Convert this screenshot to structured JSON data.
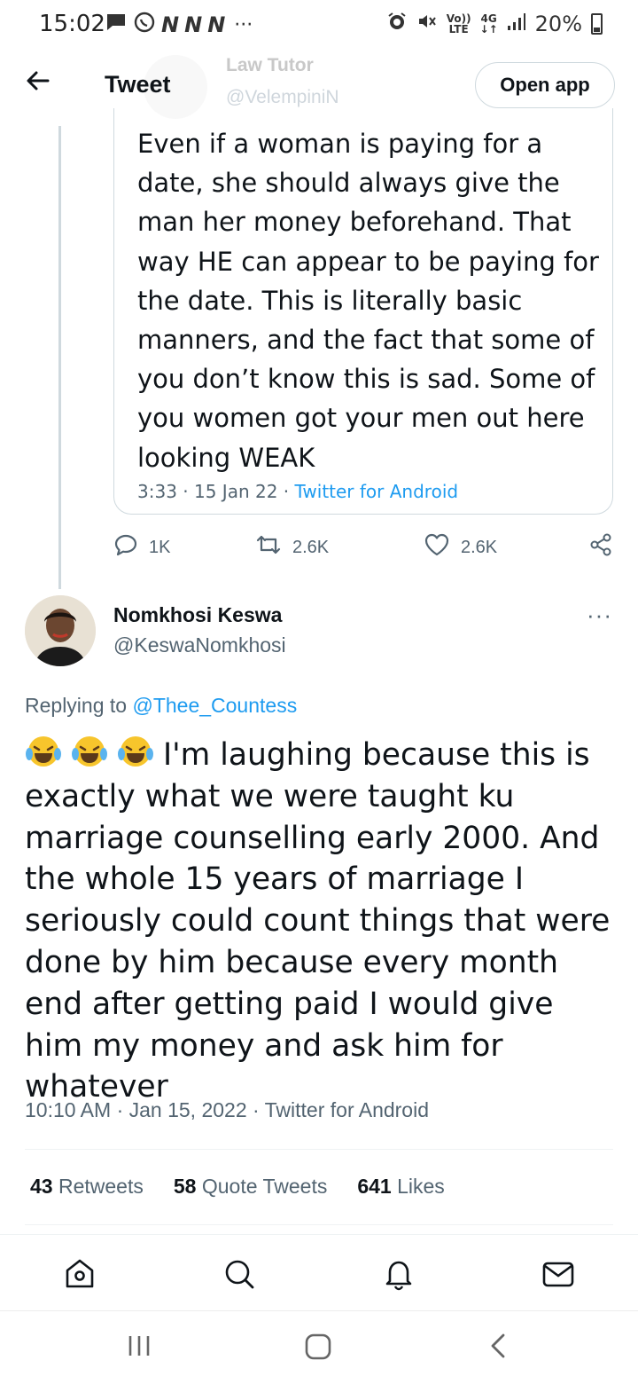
{
  "status_bar": {
    "time": "15:02",
    "lte_top": "Vo))",
    "lte_bottom": "LTE",
    "net_top": "4G",
    "net_bottom": "↓↑",
    "battery": "20%"
  },
  "header": {
    "title": "Tweet",
    "open_app_label": "Open app",
    "behind_name": "Law Tutor",
    "behind_handle": "@VelempiniN"
  },
  "quoted_tweet": {
    "text": "Even if a woman is paying for a date, she should always give the man her money beforehand. That way HE can appear to be paying for the date. This is literally basic manners, and the fact that some of you don’t know this is sad. Some of you women got your men out here looking WEAK",
    "time": "3:33 · 15 Jan 22 · ",
    "source": "Twitter for Android",
    "replies": "1K",
    "retweets": "2.6K",
    "likes": "2.6K"
  },
  "reply_tweet": {
    "name": "Nomkhosi Keswa",
    "handle": "@KeswaNomkhosi",
    "replying_prefix": "Replying to ",
    "replying_to": "@Thee_Countess",
    "body": "I'm laughing because this is exactly what we were taught ku marriage counselling early 2000. And the whole 15 years of marriage I seriously could count things that were done by him because every month end after getting paid I would give him my money and ask him for whatever",
    "timestamp": "10:10 AM · Jan 15, 2022 · Twitter for Android",
    "retweets_count": "43",
    "retweets_label": " Retweets",
    "quotes_count": "58",
    "quotes_label": " Quote Tweets",
    "likes_count": "641",
    "likes_label": " Likes"
  },
  "icons": {
    "colors": {
      "link": "#1d9bf0",
      "muted": "#536471",
      "text": "#0f1419"
    }
  }
}
